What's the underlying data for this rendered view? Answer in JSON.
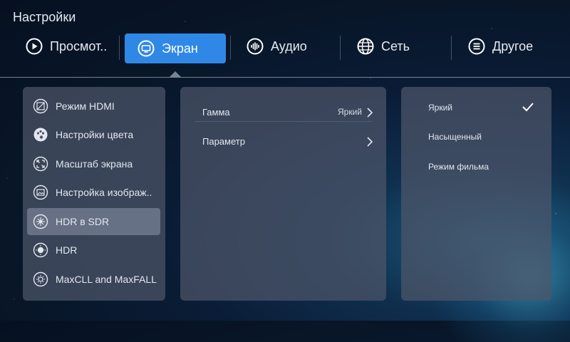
{
  "window": {
    "title": "Настройки"
  },
  "tabs": [
    {
      "label": "Просмот..",
      "icon": "play-circle-icon"
    },
    {
      "label": "Экран",
      "icon": "monitor-icon",
      "active": true
    },
    {
      "label": "Аудио",
      "icon": "audio-wave-icon"
    },
    {
      "label": "Сеть",
      "icon": "globe-icon"
    },
    {
      "label": "Другое",
      "icon": "list-menu-icon"
    }
  ],
  "sidebar": {
    "items": [
      {
        "label": "Режим HDMI",
        "icon": "hdmi-mode-icon"
      },
      {
        "label": "Настройки цвета",
        "icon": "palette-icon"
      },
      {
        "label": "Масштаб экрана",
        "icon": "screen-scale-icon"
      },
      {
        "label": "Настройка изображ..",
        "icon": "picture-settings-icon"
      },
      {
        "label": "HDR в SDR",
        "icon": "hdr-to-sdr-icon",
        "selected": true
      },
      {
        "label": "HDR",
        "icon": "hdr-icon"
      },
      {
        "label": "MaxCLL and MaxFALL",
        "icon": "brightness-icon"
      }
    ]
  },
  "settings": {
    "rows": [
      {
        "label": "Гамма",
        "value": "Яркий"
      },
      {
        "label": "Параметр",
        "value": ""
      }
    ]
  },
  "options": {
    "items": [
      {
        "label": "Яркий",
        "checked": true
      },
      {
        "label": "Насыщенный"
      },
      {
        "label": "Режим фильма"
      }
    ]
  },
  "colors": {
    "accent": "#2f88e6",
    "panel": "#4e5669",
    "background": "#081628"
  }
}
